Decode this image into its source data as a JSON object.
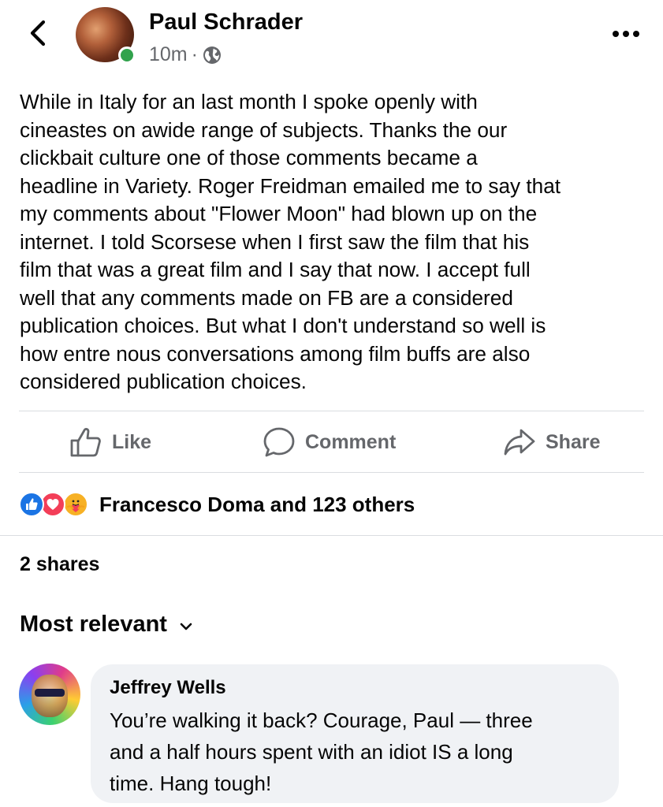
{
  "post": {
    "author": "Paul Schrader",
    "time": "10m",
    "separator": "·",
    "privacy_icon": "globe-icon",
    "author_online": true,
    "text": "While in Italy for an last month I spoke openly with\ncineastes on awide range of subjects. Thanks the our\nclickbait culture one of those comments became a\nheadline in Variety. Roger Freidman emailed me to say that\nmy comments about \"Flower Moon\" had blown up on the\ninternet. I told Scorsese when I first saw the film that his\nfilm that was a great film and I say that now. I accept full\nwell that any comments made on FB are a considered\npublication choices. But what I don't understand so well is\nhow entre nous conversations among film buffs are also\nconsidered publication choices."
  },
  "actions": {
    "like": "Like",
    "comment": "Comment",
    "share": "Share"
  },
  "reactions": {
    "icons": [
      "like-reaction-icon",
      "love-reaction-icon",
      "care-reaction-icon"
    ],
    "summary": "Francesco Doma and 123 others"
  },
  "shares": "2 shares",
  "comments_sort": {
    "label": "Most relevant"
  },
  "comments": [
    {
      "author": "Jeffrey Wells",
      "text": "You’re walking it back?  Courage, Paul — three\nand a half hours spent with an idiot IS a long\ntime.  Hang tough!"
    }
  ],
  "colors": {
    "text": "#050505",
    "secondary_text": "#65676b",
    "like_blue": "#1b74e4",
    "love_red": "#f33e58",
    "care_yellow": "#f7b125",
    "online_green": "#31a24c",
    "comment_bubble": "#f0f2f5",
    "divider": "#dadde1"
  }
}
